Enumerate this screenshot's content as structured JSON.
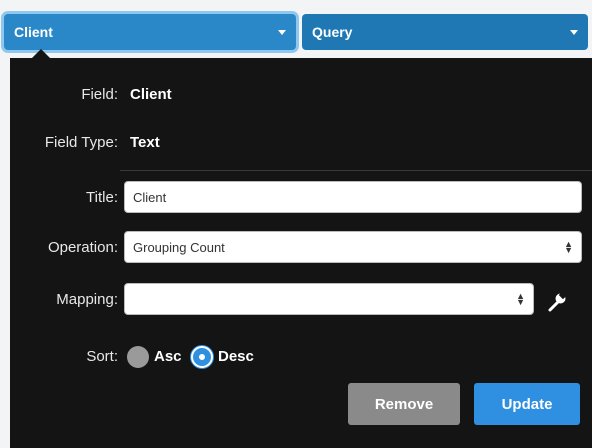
{
  "tabs": {
    "client": {
      "label": "Client"
    },
    "query": {
      "label": "Query"
    }
  },
  "panel": {
    "field_label": "Field:",
    "field_value": "Client",
    "field_type_label": "Field Type:",
    "field_type_value": "Text",
    "title_label": "Title:",
    "title_value": "Client",
    "operation_label": "Operation:",
    "operation_value": "Grouping Count",
    "mapping_label": "Mapping:",
    "mapping_value": "",
    "sort_label": "Sort:",
    "sort_options": [
      "Asc",
      "Desc"
    ],
    "sort_selected": "Desc",
    "remove_label": "Remove",
    "update_label": "Update"
  },
  "icons": {
    "dropdown": "caret-down-icon",
    "select": "updown-arrows-icon",
    "mapping_tool": "wrench-icon"
  },
  "colors": {
    "accent": "#2f8fe0",
    "tab_bg": "#1f78b4",
    "panel_bg": "#141414",
    "remove_bg": "#8a8a8a"
  }
}
